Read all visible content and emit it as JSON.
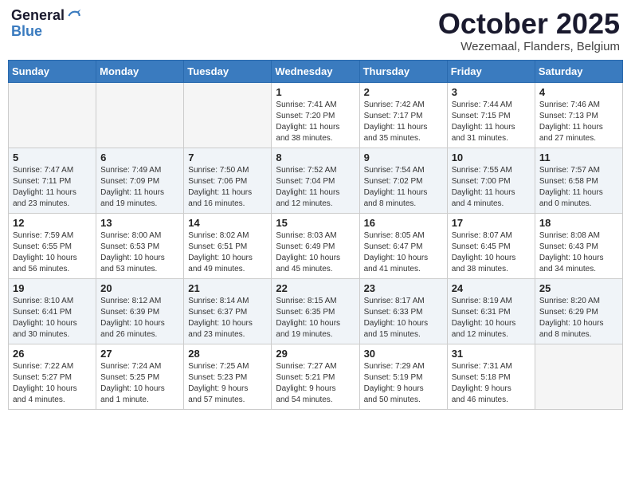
{
  "logo": {
    "line1": "General",
    "line2": "Blue"
  },
  "title": "October 2025",
  "location": "Wezemaal, Flanders, Belgium",
  "weekdays": [
    "Sunday",
    "Monday",
    "Tuesday",
    "Wednesday",
    "Thursday",
    "Friday",
    "Saturday"
  ],
  "weeks": [
    [
      {
        "day": "",
        "info": ""
      },
      {
        "day": "",
        "info": ""
      },
      {
        "day": "",
        "info": ""
      },
      {
        "day": "1",
        "info": "Sunrise: 7:41 AM\nSunset: 7:20 PM\nDaylight: 11 hours\nand 38 minutes."
      },
      {
        "day": "2",
        "info": "Sunrise: 7:42 AM\nSunset: 7:17 PM\nDaylight: 11 hours\nand 35 minutes."
      },
      {
        "day": "3",
        "info": "Sunrise: 7:44 AM\nSunset: 7:15 PM\nDaylight: 11 hours\nand 31 minutes."
      },
      {
        "day": "4",
        "info": "Sunrise: 7:46 AM\nSunset: 7:13 PM\nDaylight: 11 hours\nand 27 minutes."
      }
    ],
    [
      {
        "day": "5",
        "info": "Sunrise: 7:47 AM\nSunset: 7:11 PM\nDaylight: 11 hours\nand 23 minutes."
      },
      {
        "day": "6",
        "info": "Sunrise: 7:49 AM\nSunset: 7:09 PM\nDaylight: 11 hours\nand 19 minutes."
      },
      {
        "day": "7",
        "info": "Sunrise: 7:50 AM\nSunset: 7:06 PM\nDaylight: 11 hours\nand 16 minutes."
      },
      {
        "day": "8",
        "info": "Sunrise: 7:52 AM\nSunset: 7:04 PM\nDaylight: 11 hours\nand 12 minutes."
      },
      {
        "day": "9",
        "info": "Sunrise: 7:54 AM\nSunset: 7:02 PM\nDaylight: 11 hours\nand 8 minutes."
      },
      {
        "day": "10",
        "info": "Sunrise: 7:55 AM\nSunset: 7:00 PM\nDaylight: 11 hours\nand 4 minutes."
      },
      {
        "day": "11",
        "info": "Sunrise: 7:57 AM\nSunset: 6:58 PM\nDaylight: 11 hours\nand 0 minutes."
      }
    ],
    [
      {
        "day": "12",
        "info": "Sunrise: 7:59 AM\nSunset: 6:55 PM\nDaylight: 10 hours\nand 56 minutes."
      },
      {
        "day": "13",
        "info": "Sunrise: 8:00 AM\nSunset: 6:53 PM\nDaylight: 10 hours\nand 53 minutes."
      },
      {
        "day": "14",
        "info": "Sunrise: 8:02 AM\nSunset: 6:51 PM\nDaylight: 10 hours\nand 49 minutes."
      },
      {
        "day": "15",
        "info": "Sunrise: 8:03 AM\nSunset: 6:49 PM\nDaylight: 10 hours\nand 45 minutes."
      },
      {
        "day": "16",
        "info": "Sunrise: 8:05 AM\nSunset: 6:47 PM\nDaylight: 10 hours\nand 41 minutes."
      },
      {
        "day": "17",
        "info": "Sunrise: 8:07 AM\nSunset: 6:45 PM\nDaylight: 10 hours\nand 38 minutes."
      },
      {
        "day": "18",
        "info": "Sunrise: 8:08 AM\nSunset: 6:43 PM\nDaylight: 10 hours\nand 34 minutes."
      }
    ],
    [
      {
        "day": "19",
        "info": "Sunrise: 8:10 AM\nSunset: 6:41 PM\nDaylight: 10 hours\nand 30 minutes."
      },
      {
        "day": "20",
        "info": "Sunrise: 8:12 AM\nSunset: 6:39 PM\nDaylight: 10 hours\nand 26 minutes."
      },
      {
        "day": "21",
        "info": "Sunrise: 8:14 AM\nSunset: 6:37 PM\nDaylight: 10 hours\nand 23 minutes."
      },
      {
        "day": "22",
        "info": "Sunrise: 8:15 AM\nSunset: 6:35 PM\nDaylight: 10 hours\nand 19 minutes."
      },
      {
        "day": "23",
        "info": "Sunrise: 8:17 AM\nSunset: 6:33 PM\nDaylight: 10 hours\nand 15 minutes."
      },
      {
        "day": "24",
        "info": "Sunrise: 8:19 AM\nSunset: 6:31 PM\nDaylight: 10 hours\nand 12 minutes."
      },
      {
        "day": "25",
        "info": "Sunrise: 8:20 AM\nSunset: 6:29 PM\nDaylight: 10 hours\nand 8 minutes."
      }
    ],
    [
      {
        "day": "26",
        "info": "Sunrise: 7:22 AM\nSunset: 5:27 PM\nDaylight: 10 hours\nand 4 minutes."
      },
      {
        "day": "27",
        "info": "Sunrise: 7:24 AM\nSunset: 5:25 PM\nDaylight: 10 hours\nand 1 minute."
      },
      {
        "day": "28",
        "info": "Sunrise: 7:25 AM\nSunset: 5:23 PM\nDaylight: 9 hours\nand 57 minutes."
      },
      {
        "day": "29",
        "info": "Sunrise: 7:27 AM\nSunset: 5:21 PM\nDaylight: 9 hours\nand 54 minutes."
      },
      {
        "day": "30",
        "info": "Sunrise: 7:29 AM\nSunset: 5:19 PM\nDaylight: 9 hours\nand 50 minutes."
      },
      {
        "day": "31",
        "info": "Sunrise: 7:31 AM\nSunset: 5:18 PM\nDaylight: 9 hours\nand 46 minutes."
      },
      {
        "day": "",
        "info": ""
      }
    ]
  ]
}
